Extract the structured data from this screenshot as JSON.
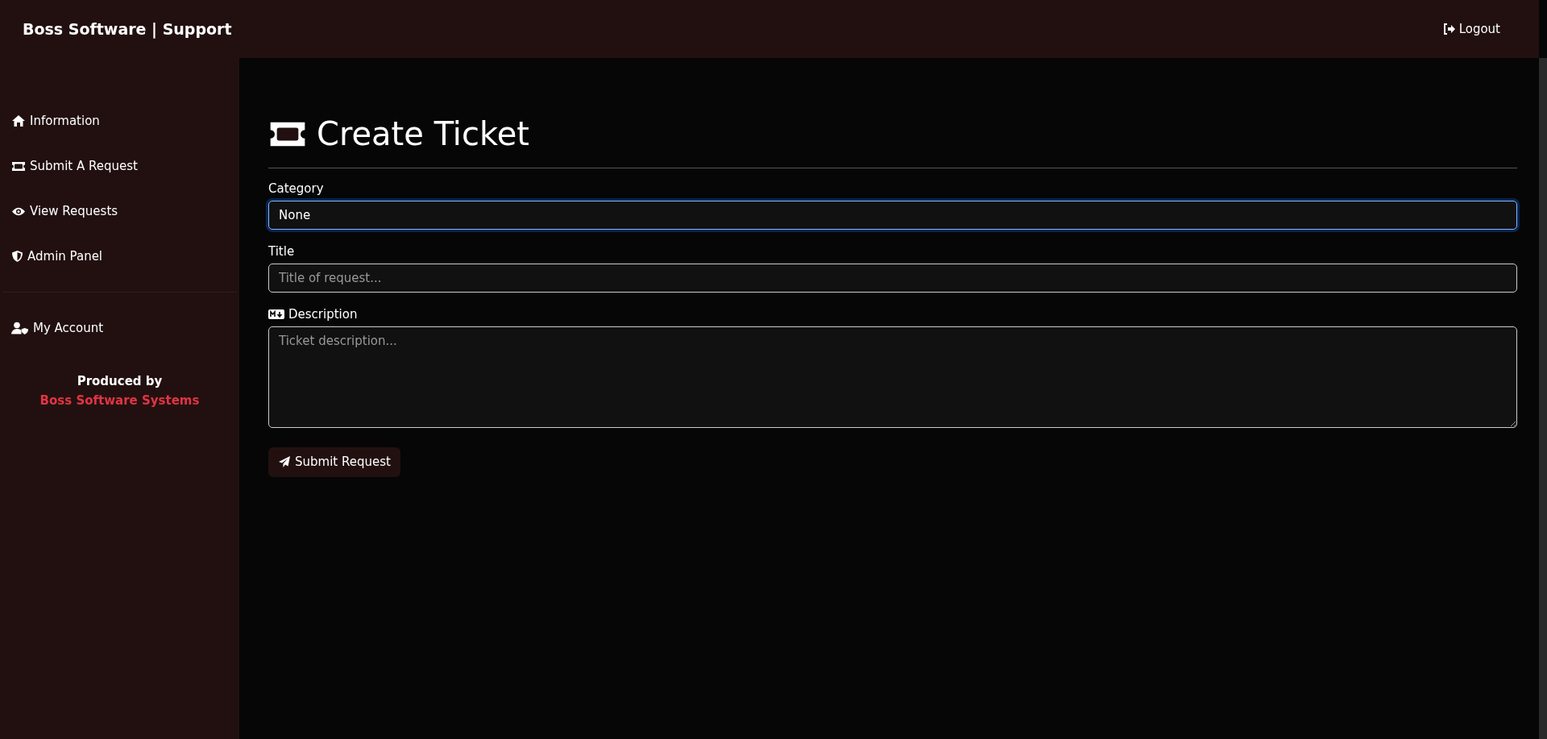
{
  "navbar": {
    "brand": "Boss Software | Support",
    "logout": "Logout"
  },
  "sidebar": {
    "items": [
      {
        "label": "Information"
      },
      {
        "label": "Submit A Request"
      },
      {
        "label": "View Requests"
      },
      {
        "label": "Admin Panel"
      }
    ],
    "account_items": [
      {
        "label": "My Account"
      }
    ],
    "credit": {
      "prefix": "Produced by",
      "link": "Boss Software Systems"
    }
  },
  "page": {
    "title": "Create Ticket",
    "form": {
      "category": {
        "label": "Category",
        "value": "None",
        "focused": true
      },
      "title": {
        "label": "Title",
        "placeholder": "Title of request..."
      },
      "description": {
        "label": "Description",
        "placeholder": "Ticket description..."
      },
      "submit": "Submit Request"
    }
  }
}
